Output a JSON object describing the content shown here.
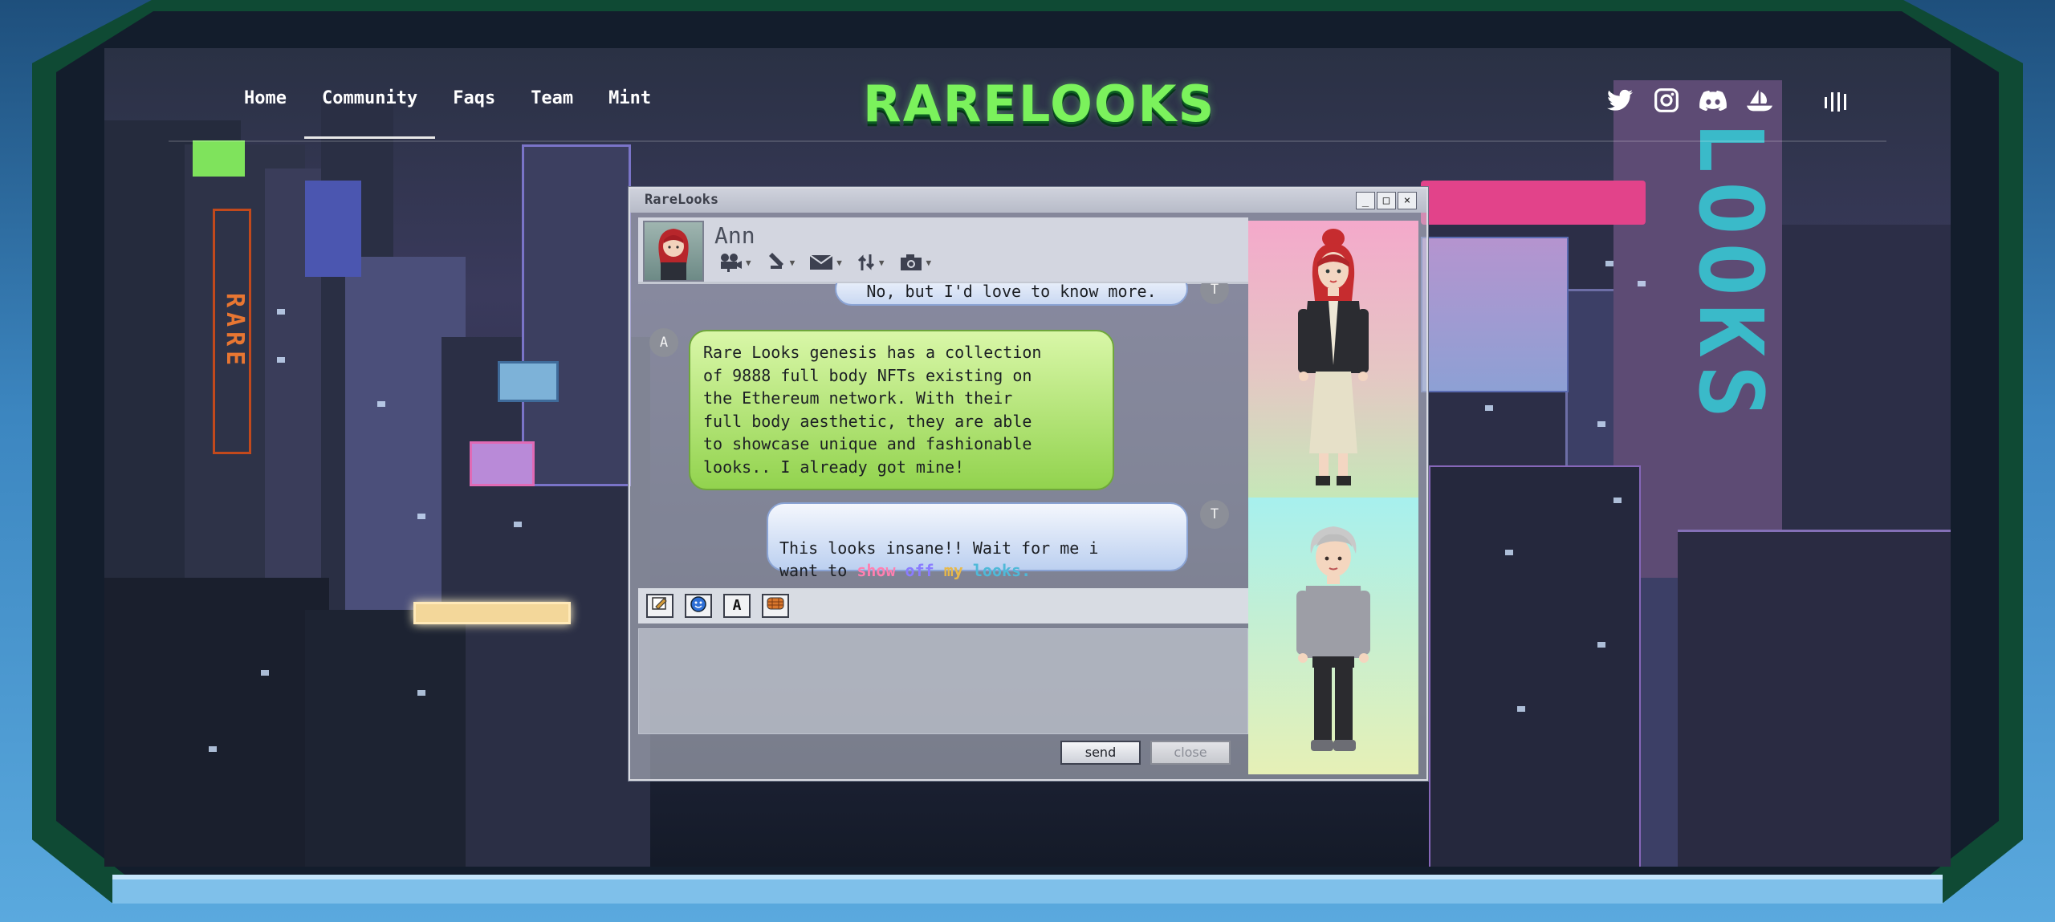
{
  "nav": {
    "links": [
      "Home",
      "Community",
      "Faqs",
      "Team",
      "Mint"
    ],
    "active": "Community"
  },
  "brand": {
    "logo_text": "RARELOOKS",
    "accent": "#7bf25c"
  },
  "socials": [
    "twitter-icon",
    "instagram-icon",
    "discord-icon",
    "opensea-icon"
  ],
  "menu_icon": "menu-bars-icon",
  "chat": {
    "window_title": "RareLooks",
    "window_buttons": [
      "_",
      "□",
      "×"
    ],
    "contact_name": "Ann",
    "toolbar_icons": [
      "video-camera-icon",
      "attachment-icon",
      "mail-icon",
      "transfer-icon",
      "camera-icon"
    ],
    "messages": [
      {
        "sender": "T",
        "text": "No, but I'd love to know more."
      },
      {
        "sender": "A",
        "text": "Rare Looks genesis has a collection\nof 9888 full body NFTs existing on\nthe Ethereum network. With their\nfull body aesthetic, they are able\nto showcase unique and fashionable\nlooks.. I already got mine!"
      },
      {
        "sender": "T",
        "text_prefix": "This looks insane!! Wait for me i\nwant to ",
        "rainbow_words": [
          "show",
          "off",
          "my",
          "looks."
        ]
      }
    ],
    "format_buttons": [
      "edit-icon",
      "emoji-icon",
      "font-icon",
      "background-icon"
    ],
    "format_font_label": "A",
    "compose_value": "",
    "send_label": "send",
    "close_label": "close"
  }
}
